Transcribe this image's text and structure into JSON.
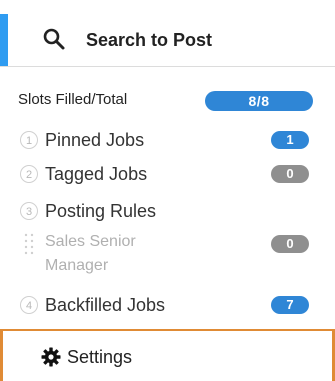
{
  "search": {
    "label": "Search to Post",
    "icon": "search-icon"
  },
  "slots": {
    "label": "Slots Filled/Total",
    "value": "8/8"
  },
  "items": [
    {
      "num": "1",
      "label": "Pinned Jobs",
      "count": "1",
      "badge_color": "#2f86d6"
    },
    {
      "num": "2",
      "label": "Tagged Jobs",
      "count": "0",
      "badge_color": "#8f8f8f"
    },
    {
      "num": "3",
      "label": "Posting Rules"
    },
    {
      "sub_label": "Sales Senior Manager",
      "count": "0",
      "badge_color": "#8f8f8f",
      "icon": "drag-handle-icon"
    },
    {
      "num": "4",
      "label": "Backfilled Jobs",
      "count": "7",
      "badge_color": "#2f86d6"
    }
  ],
  "settings": {
    "label": "Settings",
    "icon": "gear-icon"
  },
  "colors": {
    "accent": "#2f9cf1",
    "highlight_border": "#e08b35"
  }
}
